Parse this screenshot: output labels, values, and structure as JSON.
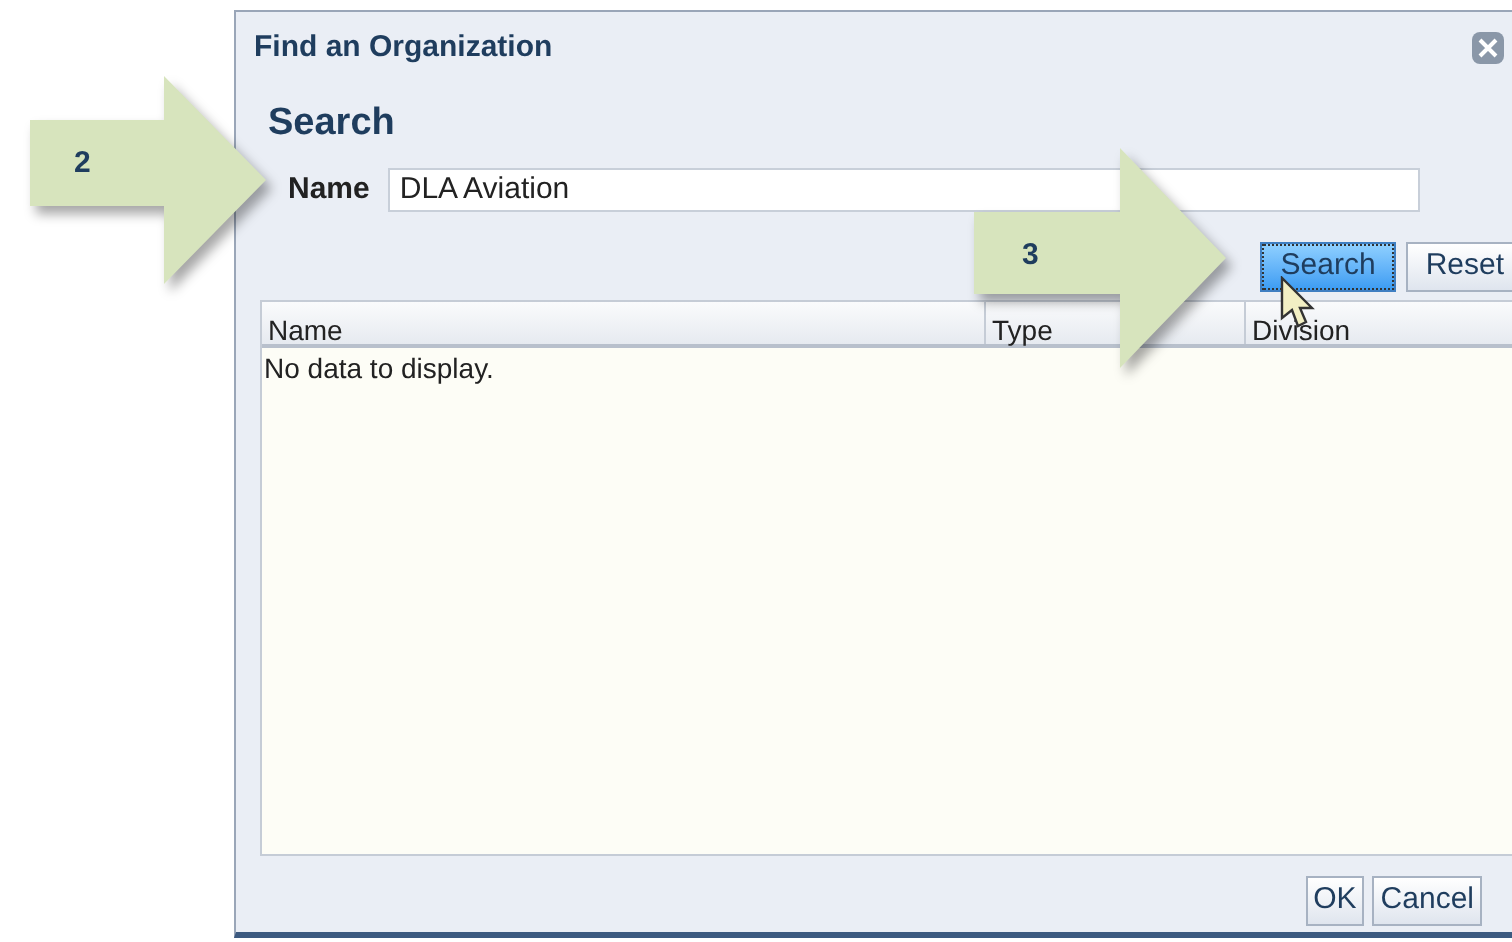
{
  "dialog": {
    "title": "Find an Organization",
    "heading": "Search",
    "name_label": "Name",
    "name_value": "DLA Aviation",
    "buttons": [
      "Search",
      "Reset"
    ],
    "table": {
      "columns": [
        "Name",
        "Type",
        "Division"
      ],
      "empty_message": "No data to display."
    },
    "footer_buttons": [
      "OK",
      "Cancel"
    ]
  },
  "callouts": [
    {
      "number": "2"
    },
    {
      "number": "3"
    }
  ]
}
